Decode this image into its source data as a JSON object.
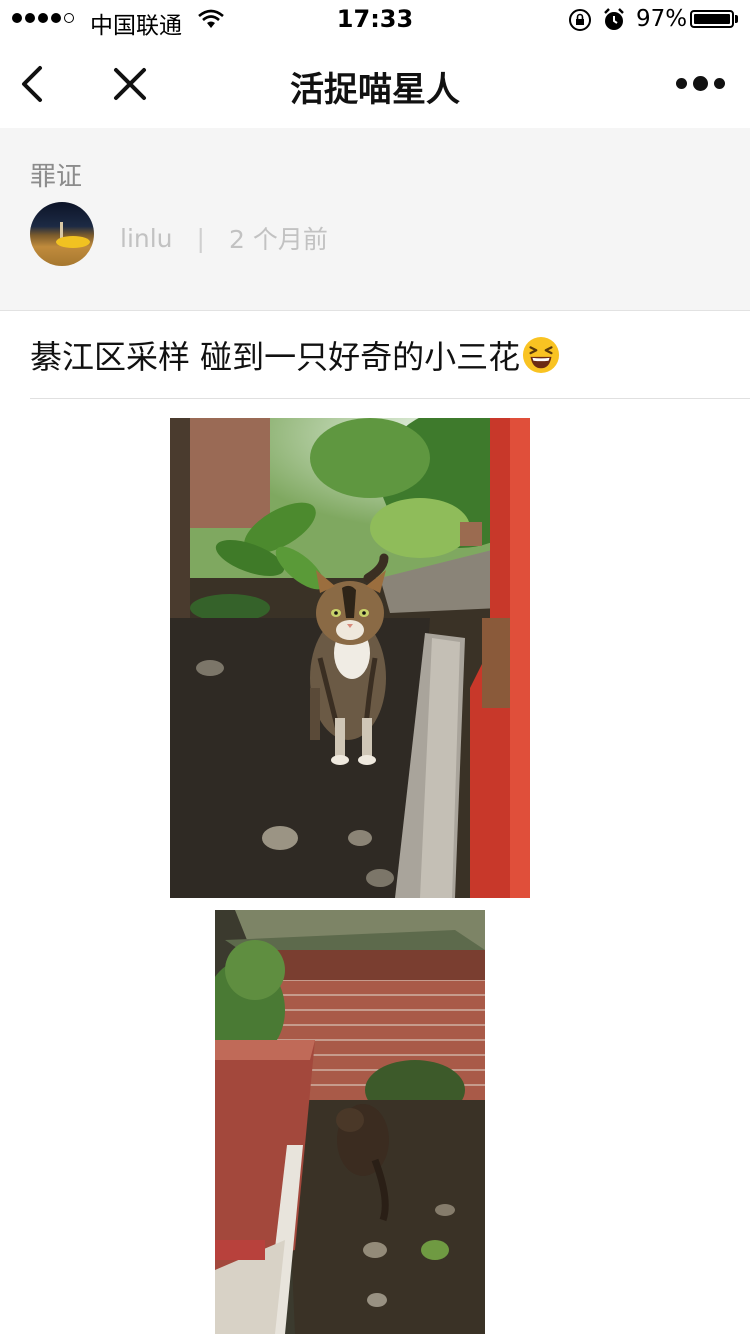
{
  "status_bar": {
    "carrier": "中国联通",
    "time": "17:33",
    "battery_percent": "97%",
    "signal_bars_filled": 4,
    "signal_bars_total": 5
  },
  "nav": {
    "title": "活捉喵星人"
  },
  "post": {
    "category": "罪证",
    "author": "linlu",
    "separator": "|",
    "time_ago": "2 个月前",
    "text": "綦江区采样 碰到一只好奇的小三花",
    "emoji": "laughing-face"
  },
  "photos": [
    {
      "name": "calico-cat-sitting-photo"
    },
    {
      "name": "cat-near-brick-wall-photo"
    }
  ],
  "colors": {
    "header_bg": "#f5f5f5",
    "muted_text": "#8c8c8c",
    "meta_text": "#c2c2c2"
  }
}
